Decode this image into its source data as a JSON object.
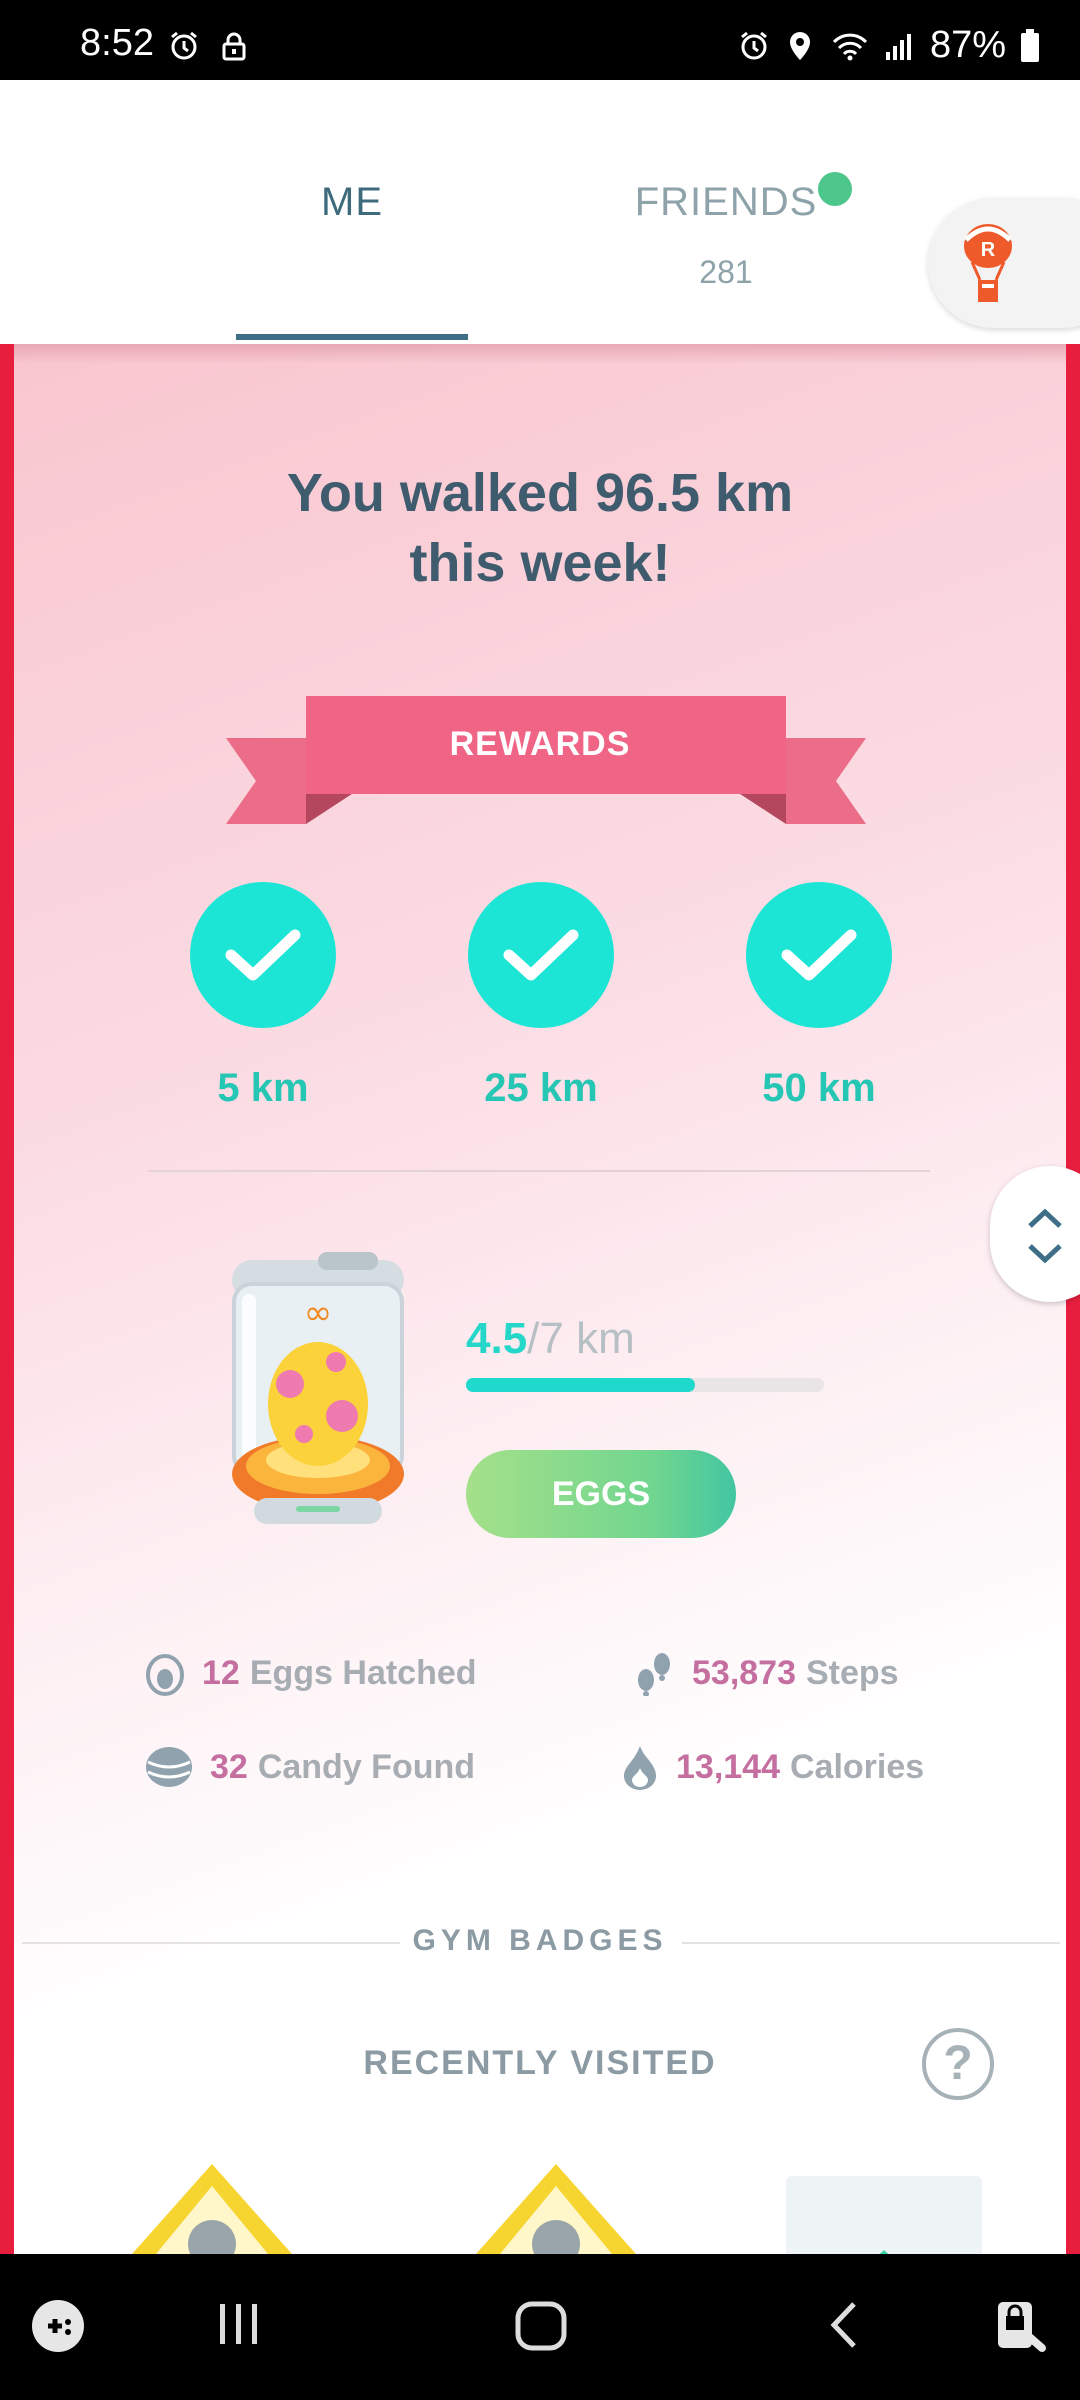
{
  "status_bar": {
    "time": "8:52",
    "battery": "87%",
    "left_icons": [
      "alarm-icon",
      "lock-icon"
    ],
    "right_icons": [
      "alarm-icon",
      "location-icon",
      "wifi-icon",
      "signal-icon",
      "battery-icon"
    ]
  },
  "header": {
    "tabs": [
      {
        "label": "ME",
        "active": true
      },
      {
        "label": "FRIENDS",
        "active": false,
        "count": "281",
        "notification": true
      }
    ],
    "corner_button_icon": "team-rocket-balloon-icon"
  },
  "weekly": {
    "title_line1": "You walked 96.5 km",
    "title_line2": "this week!",
    "rewards_label": "REWARDS",
    "rewards": [
      {
        "label": "5 km",
        "completed": true
      },
      {
        "label": "25 km",
        "completed": true
      },
      {
        "label": "50 km",
        "completed": true
      }
    ]
  },
  "incubator": {
    "progress_current": "4.5",
    "progress_total": "/7 km",
    "progress_fraction": 0.64,
    "eggs_button": "EGGS"
  },
  "stats": [
    {
      "icon": "egg-icon",
      "value": "12",
      "label": "Eggs Hatched"
    },
    {
      "icon": "footsteps-icon",
      "value": "53,873",
      "label": "Steps"
    },
    {
      "icon": "candy-icon",
      "value": "32",
      "label": "Candy Found"
    },
    {
      "icon": "flame-icon",
      "value": "13,144",
      "label": "Calories"
    }
  ],
  "gym_badges": {
    "section_title": "GYM BADGES",
    "subtitle": "RECENTLY VISITED"
  },
  "colors": {
    "accent_teal": "#1de5d5",
    "ribbon_pink": "#f06a85",
    "border_red": "#e81e3e"
  }
}
